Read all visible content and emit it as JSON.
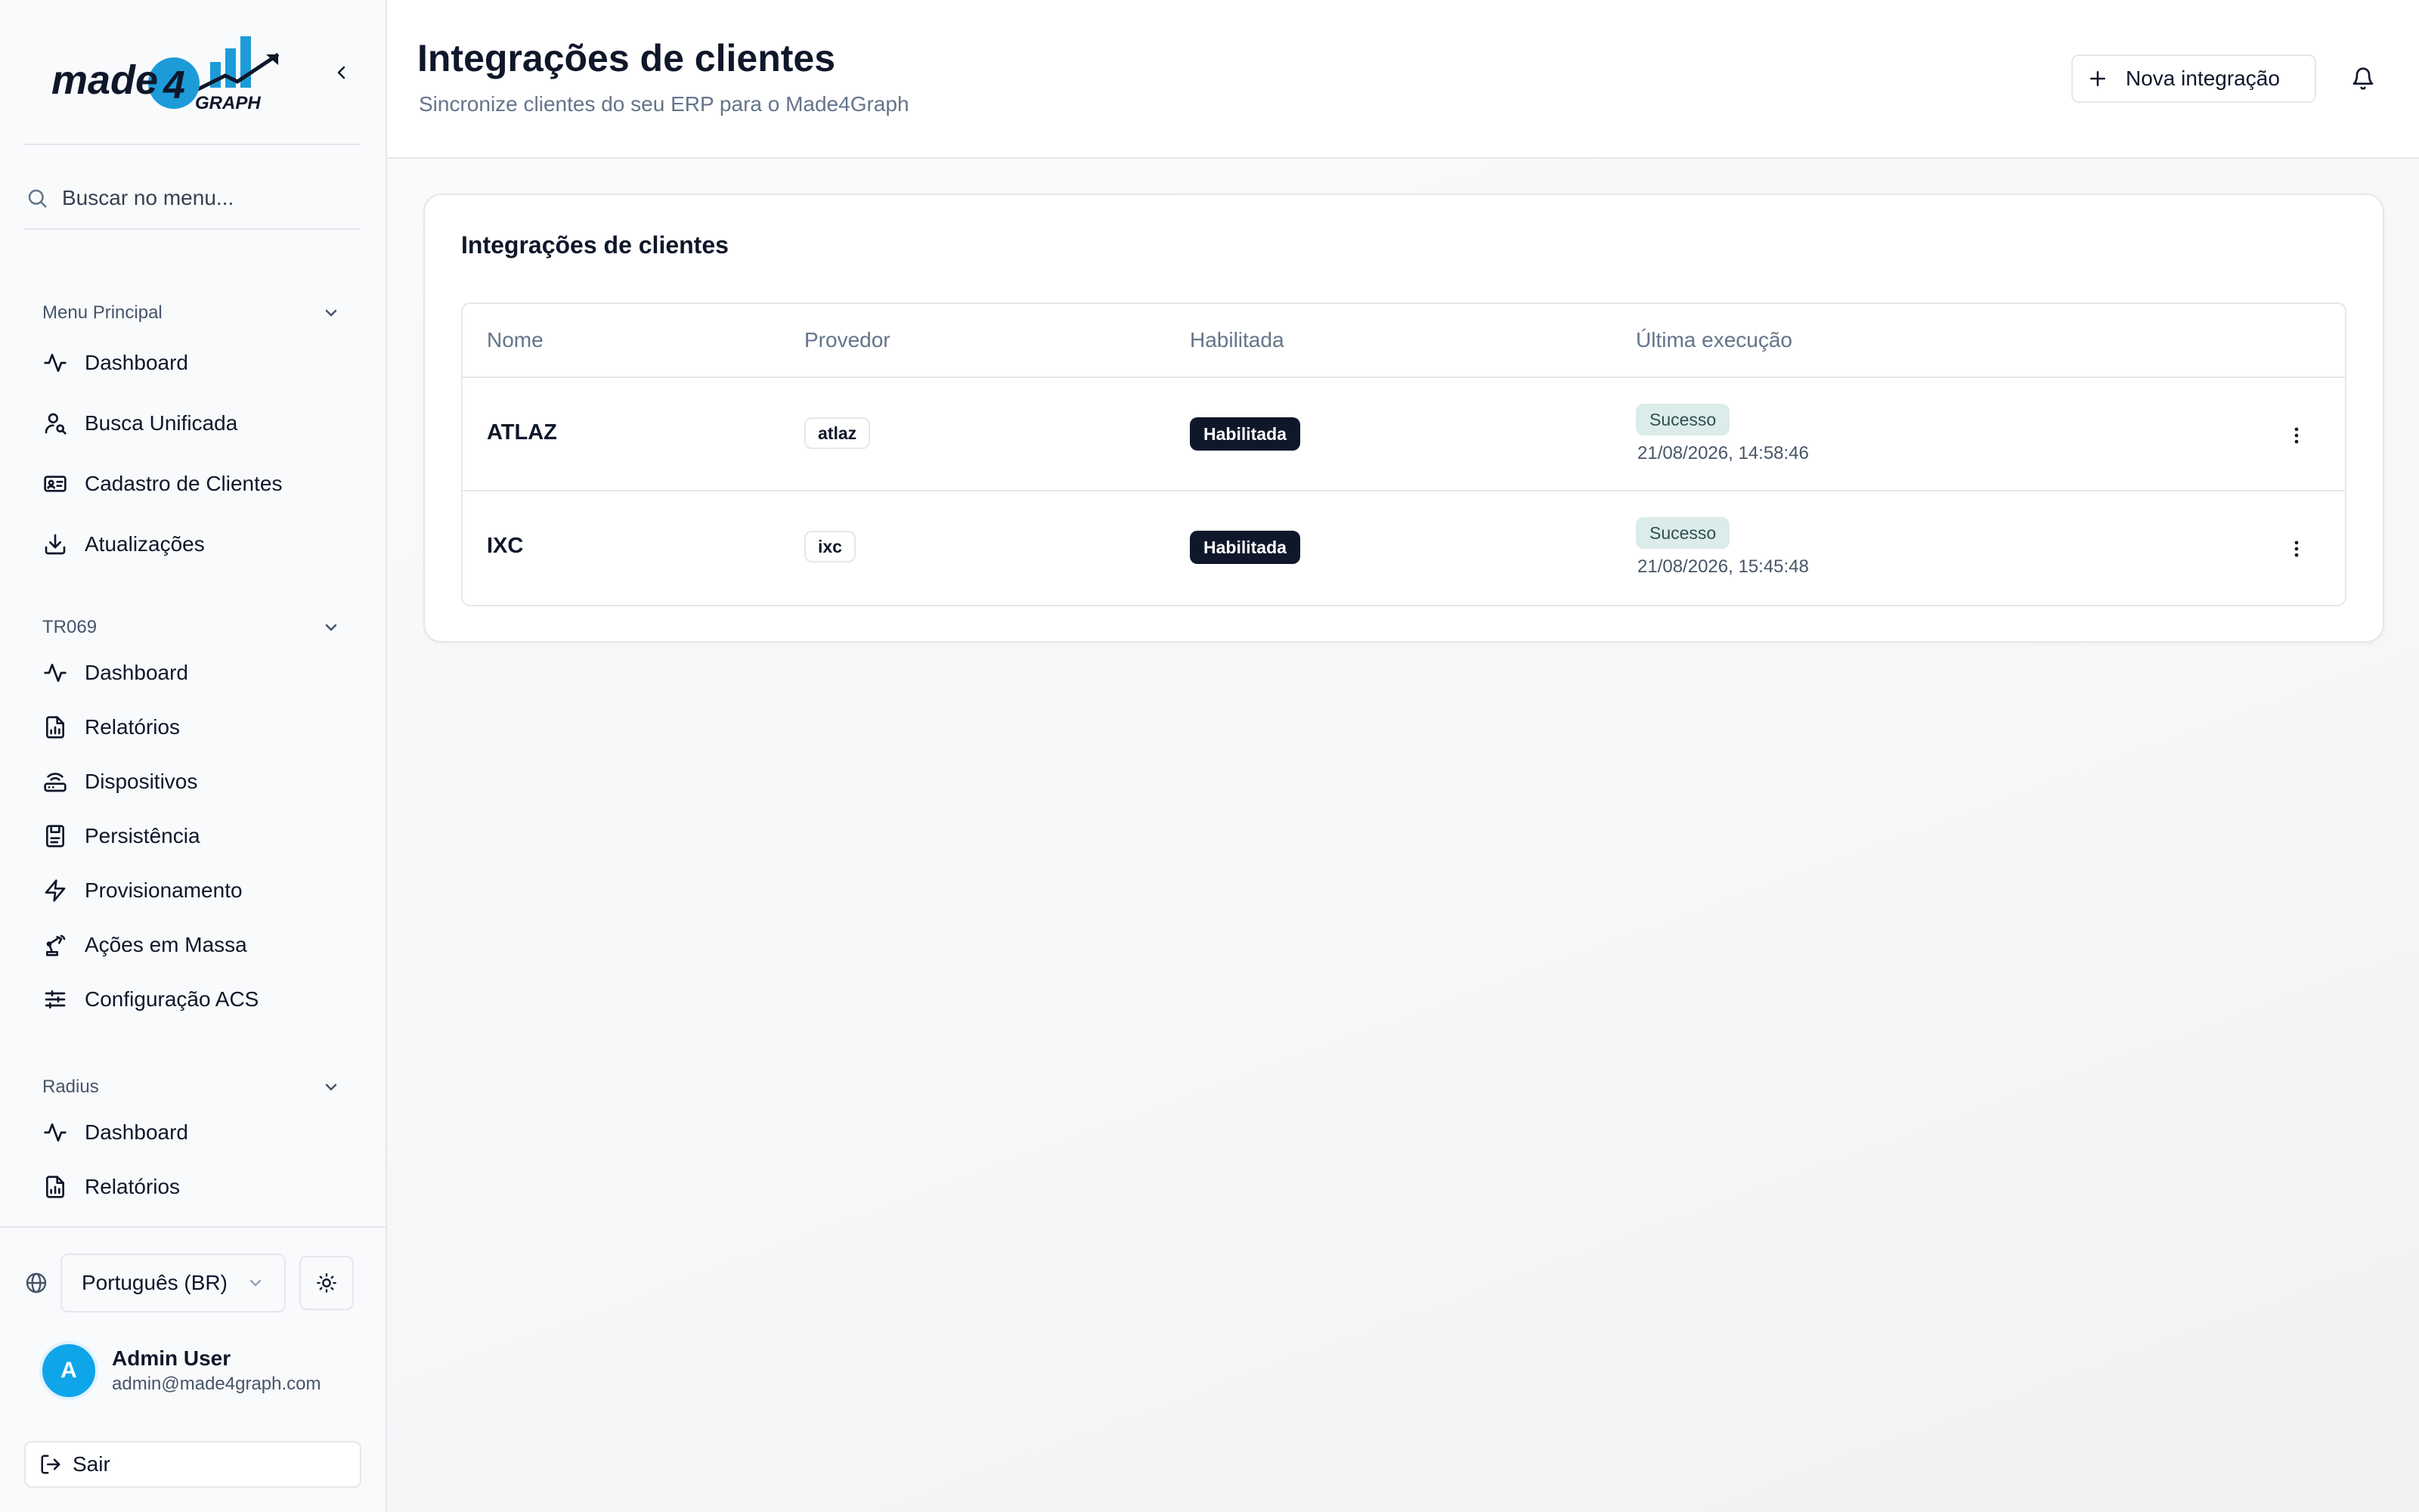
{
  "logo": {
    "text": "made4GRAPH",
    "wordmark_colors": {
      "made": "#0f172a",
      "accent": "#1d9bd8"
    }
  },
  "sidebar": {
    "search_placeholder": "Buscar no menu...",
    "sections": [
      {
        "title": "Menu Principal",
        "items": [
          {
            "label": "Dashboard",
            "icon": "activity-icon"
          },
          {
            "label": "Busca Unificada",
            "icon": "user-search-icon"
          },
          {
            "label": "Cadastro de Clientes",
            "icon": "id-card-icon"
          },
          {
            "label": "Atualizações",
            "icon": "download-icon"
          }
        ]
      },
      {
        "title": "TR069",
        "items": [
          {
            "label": "Dashboard",
            "icon": "activity-icon"
          },
          {
            "label": "Relatórios",
            "icon": "file-chart-icon"
          },
          {
            "label": "Dispositivos",
            "icon": "router-icon"
          },
          {
            "label": "Persistência",
            "icon": "save-icon"
          },
          {
            "label": "Provisionamento",
            "icon": "zap-icon"
          },
          {
            "label": "Ações em Massa",
            "icon": "robot-arm-icon"
          },
          {
            "label": "Configuração ACS",
            "icon": "sliders-icon"
          }
        ]
      },
      {
        "title": "Radius",
        "items": [
          {
            "label": "Dashboard",
            "icon": "activity-icon"
          },
          {
            "label": "Relatórios",
            "icon": "file-chart-icon"
          }
        ]
      }
    ],
    "language": "Português (BR)",
    "user": {
      "initial": "A",
      "name": "Admin User",
      "email": "admin@made4graph.com"
    },
    "logout_label": "Sair"
  },
  "header": {
    "title": "Integrações de clientes",
    "subtitle": "Sincronize clientes do seu ERP para o Made4Graph",
    "new_button": "Nova integração"
  },
  "card": {
    "title": "Integrações de clientes",
    "columns": [
      "Nome",
      "Provedor",
      "Habilitada",
      "Última execução"
    ],
    "rows": [
      {
        "name": "ATLAZ",
        "provider": "atlaz",
        "enabled": "Habilitada",
        "status": "Sucesso",
        "last_run": "21/08/2026, 14:58:46"
      },
      {
        "name": "IXC",
        "provider": "ixc",
        "enabled": "Habilitada",
        "status": "Sucesso",
        "last_run": "21/08/2026, 15:45:48"
      }
    ]
  },
  "colors": {
    "avatar": "#0ea5e9",
    "badge_dark": "#0f172a",
    "status_bg": "#dceceb"
  }
}
